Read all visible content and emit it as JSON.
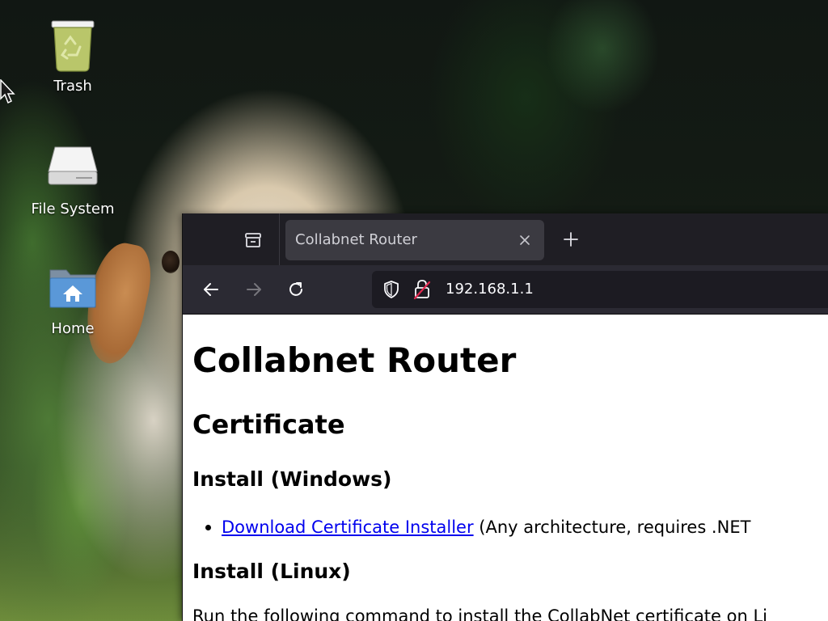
{
  "desktop": {
    "icons": [
      {
        "label": "Trash",
        "icon": "trash-icon"
      },
      {
        "label": "File System",
        "icon": "drive-icon"
      },
      {
        "label": "Home",
        "icon": "home-folder-icon"
      }
    ]
  },
  "browser": {
    "tab": {
      "title": "Collabnet Router",
      "close_icon": "close-icon"
    },
    "tab_list_icon": "tab-list-icon",
    "new_tab_icon": "plus-icon",
    "nav": {
      "back_icon": "arrow-left-icon",
      "forward_icon": "arrow-right-icon",
      "reload_icon": "reload-icon"
    },
    "url": {
      "shield_icon": "shield-icon",
      "lock_icon": "insecure-lock-icon",
      "value": "192.168.1.1"
    }
  },
  "page": {
    "h1": "Collabnet Router",
    "h2": "Certificate",
    "install_windows_heading": "Install (Windows)",
    "download_link": "Download Certificate Installer",
    "download_note": " (Any architecture, requires .NET",
    "install_linux_heading": "Install (Linux)",
    "linux_paragraph": "Run the following command to install the CollabNet certificate on Li"
  },
  "colors": {
    "tabbar": "#1f1e24",
    "navbar": "#2b2a33",
    "urlbar": "#1c1b22",
    "link": "#0000ee",
    "insecure_lock": "#e22850"
  }
}
